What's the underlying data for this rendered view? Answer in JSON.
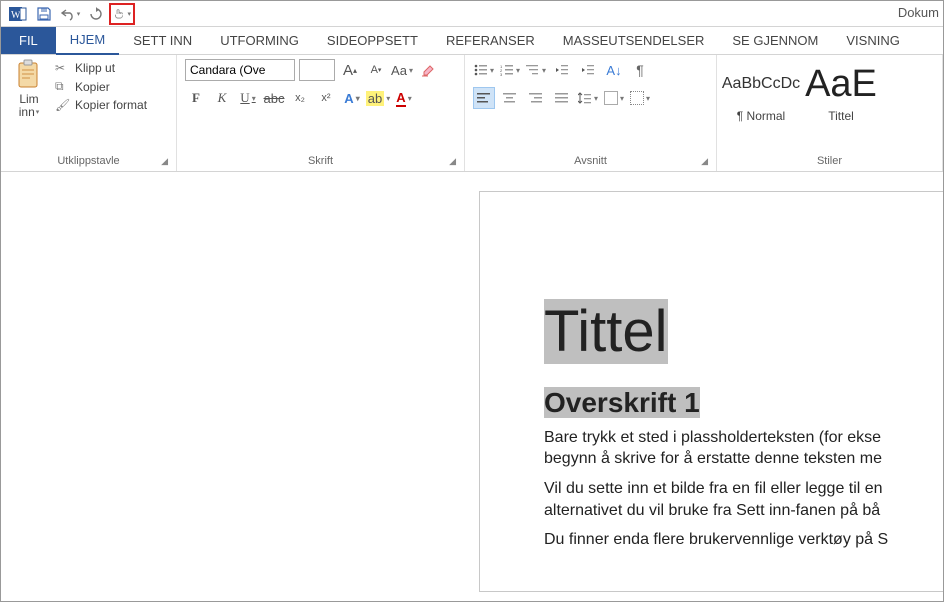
{
  "app": {
    "doc_name": "Dokum"
  },
  "qat": {
    "items": [
      "word-icon",
      "save-icon",
      "undo-icon",
      "redo-icon",
      "touch-mode-icon"
    ]
  },
  "tabs": {
    "file": "FIL",
    "items": [
      "HJEM",
      "SETT INN",
      "UTFORMING",
      "SIDEOPPSETT",
      "REFERANSER",
      "MASSEUTSENDELSER",
      "SE GJENNOM",
      "VISNING"
    ],
    "active_index": 0
  },
  "ribbon": {
    "clipboard": {
      "label": "Utklippstavle",
      "paste": "Lim inn",
      "cut": "Klipp ut",
      "copy": "Kopier",
      "format_painter": "Kopier format"
    },
    "font": {
      "label": "Skrift",
      "name": "Candara (Ove",
      "size": "",
      "grow": "A",
      "shrink": "A",
      "case": "Aa",
      "clear": "⌫",
      "bold": "F",
      "italic": "K",
      "underline": "U",
      "strike": "abc",
      "sub": "x₂",
      "sup": "x²",
      "text_effects": "A",
      "highlight": "ab",
      "font_color": "A"
    },
    "paragraph": {
      "label": "Avsnitt"
    },
    "styles": {
      "label": "Stiler",
      "items": [
        {
          "preview": "AaBbCcDc",
          "name": "¶ Normal"
        },
        {
          "preview": "AaE",
          "name": "Tittel"
        }
      ]
    }
  },
  "document": {
    "title": "Tittel",
    "h1": "Overskrift 1",
    "p1a": "Bare trykk et sted i plassholderteksten (for ekse",
    "p1b": "begynn å skrive for å erstatte denne teksten me",
    "p2a": "Vil du sette inn et bilde fra en fil eller legge til en",
    "p2b": "alternativet du vil bruke fra Sett inn-fanen på bå",
    "p3": "Du finner enda flere brukervennlige verktøy på S"
  }
}
